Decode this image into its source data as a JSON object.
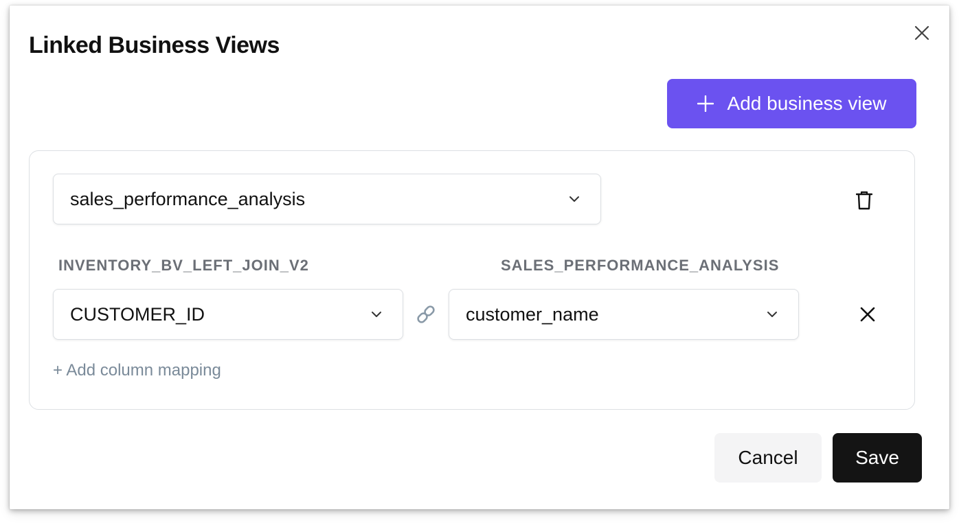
{
  "dialog": {
    "title": "Linked Business Views",
    "close_icon": "close-icon"
  },
  "toolbar": {
    "add_business_view_label": "Add business view",
    "add_icon": "plus-icon"
  },
  "business_view_card": {
    "selected_view": "sales_performance_analysis",
    "delete_icon": "trash-icon",
    "mapping": {
      "left_header": "INVENTORY_BV_LEFT_JOIN_V2",
      "right_header": "SALES_PERFORMANCE_ANALYSIS",
      "rows": [
        {
          "left_value": "CUSTOMER_ID",
          "right_value": "customer_name",
          "link_icon": "link-icon",
          "remove_icon": "close-icon"
        }
      ]
    },
    "add_mapping_label": "+ Add column mapping"
  },
  "footer": {
    "cancel_label": "Cancel",
    "save_label": "Save"
  },
  "colors": {
    "primary": "#6b52f0",
    "save": "#141414",
    "cancel_bg": "#f4f4f5",
    "muted_text": "#6b6f76",
    "link_text": "#7a8a99",
    "border": "#dcdfe3"
  }
}
